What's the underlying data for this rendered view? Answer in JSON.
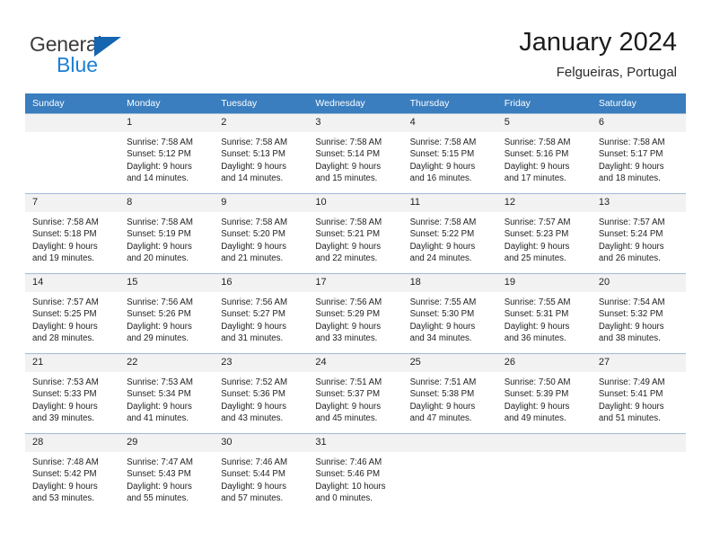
{
  "brand": {
    "name_part1": "General",
    "name_part2": "Blue",
    "triangle_color": "#1565b0",
    "blue_color": "#1b7fd4"
  },
  "header": {
    "title": "January 2024",
    "subtitle": "Felgueiras, Portugal",
    "header_bg_color": "#3a7ebf",
    "daynum_band_color": "#f2f2f2"
  },
  "calendar": {
    "weekday_headers": [
      "Sunday",
      "Monday",
      "Tuesday",
      "Wednesday",
      "Thursday",
      "Friday",
      "Saturday"
    ],
    "weeks": [
      [
        {
          "day": "",
          "lines": []
        },
        {
          "day": "1",
          "lines": [
            "Sunrise: 7:58 AM",
            "Sunset: 5:12 PM",
            "Daylight: 9 hours",
            "and 14 minutes."
          ]
        },
        {
          "day": "2",
          "lines": [
            "Sunrise: 7:58 AM",
            "Sunset: 5:13 PM",
            "Daylight: 9 hours",
            "and 14 minutes."
          ]
        },
        {
          "day": "3",
          "lines": [
            "Sunrise: 7:58 AM",
            "Sunset: 5:14 PM",
            "Daylight: 9 hours",
            "and 15 minutes."
          ]
        },
        {
          "day": "4",
          "lines": [
            "Sunrise: 7:58 AM",
            "Sunset: 5:15 PM",
            "Daylight: 9 hours",
            "and 16 minutes."
          ]
        },
        {
          "day": "5",
          "lines": [
            "Sunrise: 7:58 AM",
            "Sunset: 5:16 PM",
            "Daylight: 9 hours",
            "and 17 minutes."
          ]
        },
        {
          "day": "6",
          "lines": [
            "Sunrise: 7:58 AM",
            "Sunset: 5:17 PM",
            "Daylight: 9 hours",
            "and 18 minutes."
          ]
        }
      ],
      [
        {
          "day": "7",
          "lines": [
            "Sunrise: 7:58 AM",
            "Sunset: 5:18 PM",
            "Daylight: 9 hours",
            "and 19 minutes."
          ]
        },
        {
          "day": "8",
          "lines": [
            "Sunrise: 7:58 AM",
            "Sunset: 5:19 PM",
            "Daylight: 9 hours",
            "and 20 minutes."
          ]
        },
        {
          "day": "9",
          "lines": [
            "Sunrise: 7:58 AM",
            "Sunset: 5:20 PM",
            "Daylight: 9 hours",
            "and 21 minutes."
          ]
        },
        {
          "day": "10",
          "lines": [
            "Sunrise: 7:58 AM",
            "Sunset: 5:21 PM",
            "Daylight: 9 hours",
            "and 22 minutes."
          ]
        },
        {
          "day": "11",
          "lines": [
            "Sunrise: 7:58 AM",
            "Sunset: 5:22 PM",
            "Daylight: 9 hours",
            "and 24 minutes."
          ]
        },
        {
          "day": "12",
          "lines": [
            "Sunrise: 7:57 AM",
            "Sunset: 5:23 PM",
            "Daylight: 9 hours",
            "and 25 minutes."
          ]
        },
        {
          "day": "13",
          "lines": [
            "Sunrise: 7:57 AM",
            "Sunset: 5:24 PM",
            "Daylight: 9 hours",
            "and 26 minutes."
          ]
        }
      ],
      [
        {
          "day": "14",
          "lines": [
            "Sunrise: 7:57 AM",
            "Sunset: 5:25 PM",
            "Daylight: 9 hours",
            "and 28 minutes."
          ]
        },
        {
          "day": "15",
          "lines": [
            "Sunrise: 7:56 AM",
            "Sunset: 5:26 PM",
            "Daylight: 9 hours",
            "and 29 minutes."
          ]
        },
        {
          "day": "16",
          "lines": [
            "Sunrise: 7:56 AM",
            "Sunset: 5:27 PM",
            "Daylight: 9 hours",
            "and 31 minutes."
          ]
        },
        {
          "day": "17",
          "lines": [
            "Sunrise: 7:56 AM",
            "Sunset: 5:29 PM",
            "Daylight: 9 hours",
            "and 33 minutes."
          ]
        },
        {
          "day": "18",
          "lines": [
            "Sunrise: 7:55 AM",
            "Sunset: 5:30 PM",
            "Daylight: 9 hours",
            "and 34 minutes."
          ]
        },
        {
          "day": "19",
          "lines": [
            "Sunrise: 7:55 AM",
            "Sunset: 5:31 PM",
            "Daylight: 9 hours",
            "and 36 minutes."
          ]
        },
        {
          "day": "20",
          "lines": [
            "Sunrise: 7:54 AM",
            "Sunset: 5:32 PM",
            "Daylight: 9 hours",
            "and 38 minutes."
          ]
        }
      ],
      [
        {
          "day": "21",
          "lines": [
            "Sunrise: 7:53 AM",
            "Sunset: 5:33 PM",
            "Daylight: 9 hours",
            "and 39 minutes."
          ]
        },
        {
          "day": "22",
          "lines": [
            "Sunrise: 7:53 AM",
            "Sunset: 5:34 PM",
            "Daylight: 9 hours",
            "and 41 minutes."
          ]
        },
        {
          "day": "23",
          "lines": [
            "Sunrise: 7:52 AM",
            "Sunset: 5:36 PM",
            "Daylight: 9 hours",
            "and 43 minutes."
          ]
        },
        {
          "day": "24",
          "lines": [
            "Sunrise: 7:51 AM",
            "Sunset: 5:37 PM",
            "Daylight: 9 hours",
            "and 45 minutes."
          ]
        },
        {
          "day": "25",
          "lines": [
            "Sunrise: 7:51 AM",
            "Sunset: 5:38 PM",
            "Daylight: 9 hours",
            "and 47 minutes."
          ]
        },
        {
          "day": "26",
          "lines": [
            "Sunrise: 7:50 AM",
            "Sunset: 5:39 PM",
            "Daylight: 9 hours",
            "and 49 minutes."
          ]
        },
        {
          "day": "27",
          "lines": [
            "Sunrise: 7:49 AM",
            "Sunset: 5:41 PM",
            "Daylight: 9 hours",
            "and 51 minutes."
          ]
        }
      ],
      [
        {
          "day": "28",
          "lines": [
            "Sunrise: 7:48 AM",
            "Sunset: 5:42 PM",
            "Daylight: 9 hours",
            "and 53 minutes."
          ]
        },
        {
          "day": "29",
          "lines": [
            "Sunrise: 7:47 AM",
            "Sunset: 5:43 PM",
            "Daylight: 9 hours",
            "and 55 minutes."
          ]
        },
        {
          "day": "30",
          "lines": [
            "Sunrise: 7:46 AM",
            "Sunset: 5:44 PM",
            "Daylight: 9 hours",
            "and 57 minutes."
          ]
        },
        {
          "day": "31",
          "lines": [
            "Sunrise: 7:46 AM",
            "Sunset: 5:46 PM",
            "Daylight: 10 hours",
            "and 0 minutes."
          ]
        },
        {
          "day": "",
          "lines": []
        },
        {
          "day": "",
          "lines": []
        },
        {
          "day": "",
          "lines": []
        }
      ]
    ]
  }
}
